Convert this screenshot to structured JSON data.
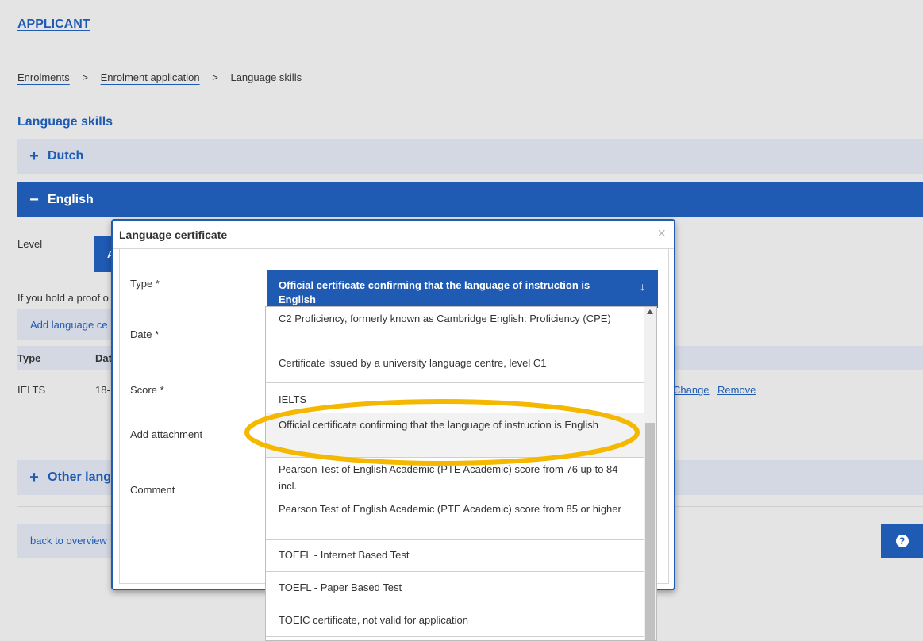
{
  "header": {
    "applicant_label": "APPLICANT"
  },
  "breadcrumb": {
    "items": [
      "Enrolments",
      "Enrolment application",
      "Language skills"
    ],
    "separator": ">"
  },
  "section_title": "Language skills",
  "accordion": {
    "dutch": {
      "label": "Dutch",
      "sign": "+"
    },
    "english": {
      "label": "English",
      "sign": "−"
    },
    "other": {
      "label": "Other lang",
      "sign": "+"
    }
  },
  "english_panel": {
    "level_label": "Level",
    "level_value": "A",
    "proof_text": "If you hold a proof o",
    "add_certificate_label": "Add language ce",
    "table": {
      "headers": [
        "Type",
        "Dat"
      ],
      "row": {
        "type": "IELTS",
        "date": "18-",
        "change_label": "Change",
        "remove_label": "Remove"
      }
    }
  },
  "footer": {
    "back_label": "back to overview",
    "help_icon": "?"
  },
  "modal": {
    "title": "Language certificate",
    "close_icon": "×",
    "fields": {
      "type_label": "Type *",
      "date_label": "Date *",
      "score_label": "Score *",
      "attachment_label": "Add attachment",
      "comment_label": "Comment"
    },
    "type_select": {
      "selected": "Official certificate confirming that the language of instruction is English",
      "arrow_icon": "↓"
    },
    "dropdown_options": [
      "C2 Proficiency, formerly known as Cambridge English: Proficiency (CPE)",
      "Certificate issued by a university language centre, level C1",
      "IELTS",
      "Official certificate confirming that the language of instruction is English",
      "Pearson Test of English Academic (PTE Academic) score from 76 up to 84 incl.",
      "Pearson Test of English Academic (PTE Academic) score from 85 or higher",
      "TOEFL - Internet Based Test",
      "TOEFL - Paper Based Test",
      "TOEIC certificate, not valid for application"
    ],
    "highlighted_option_index": 3
  },
  "colors": {
    "primary": "#1f5bb3",
    "bar_light": "#d3d8e3",
    "page_bg": "#e4e4e4",
    "annotation": "#f5b800"
  }
}
